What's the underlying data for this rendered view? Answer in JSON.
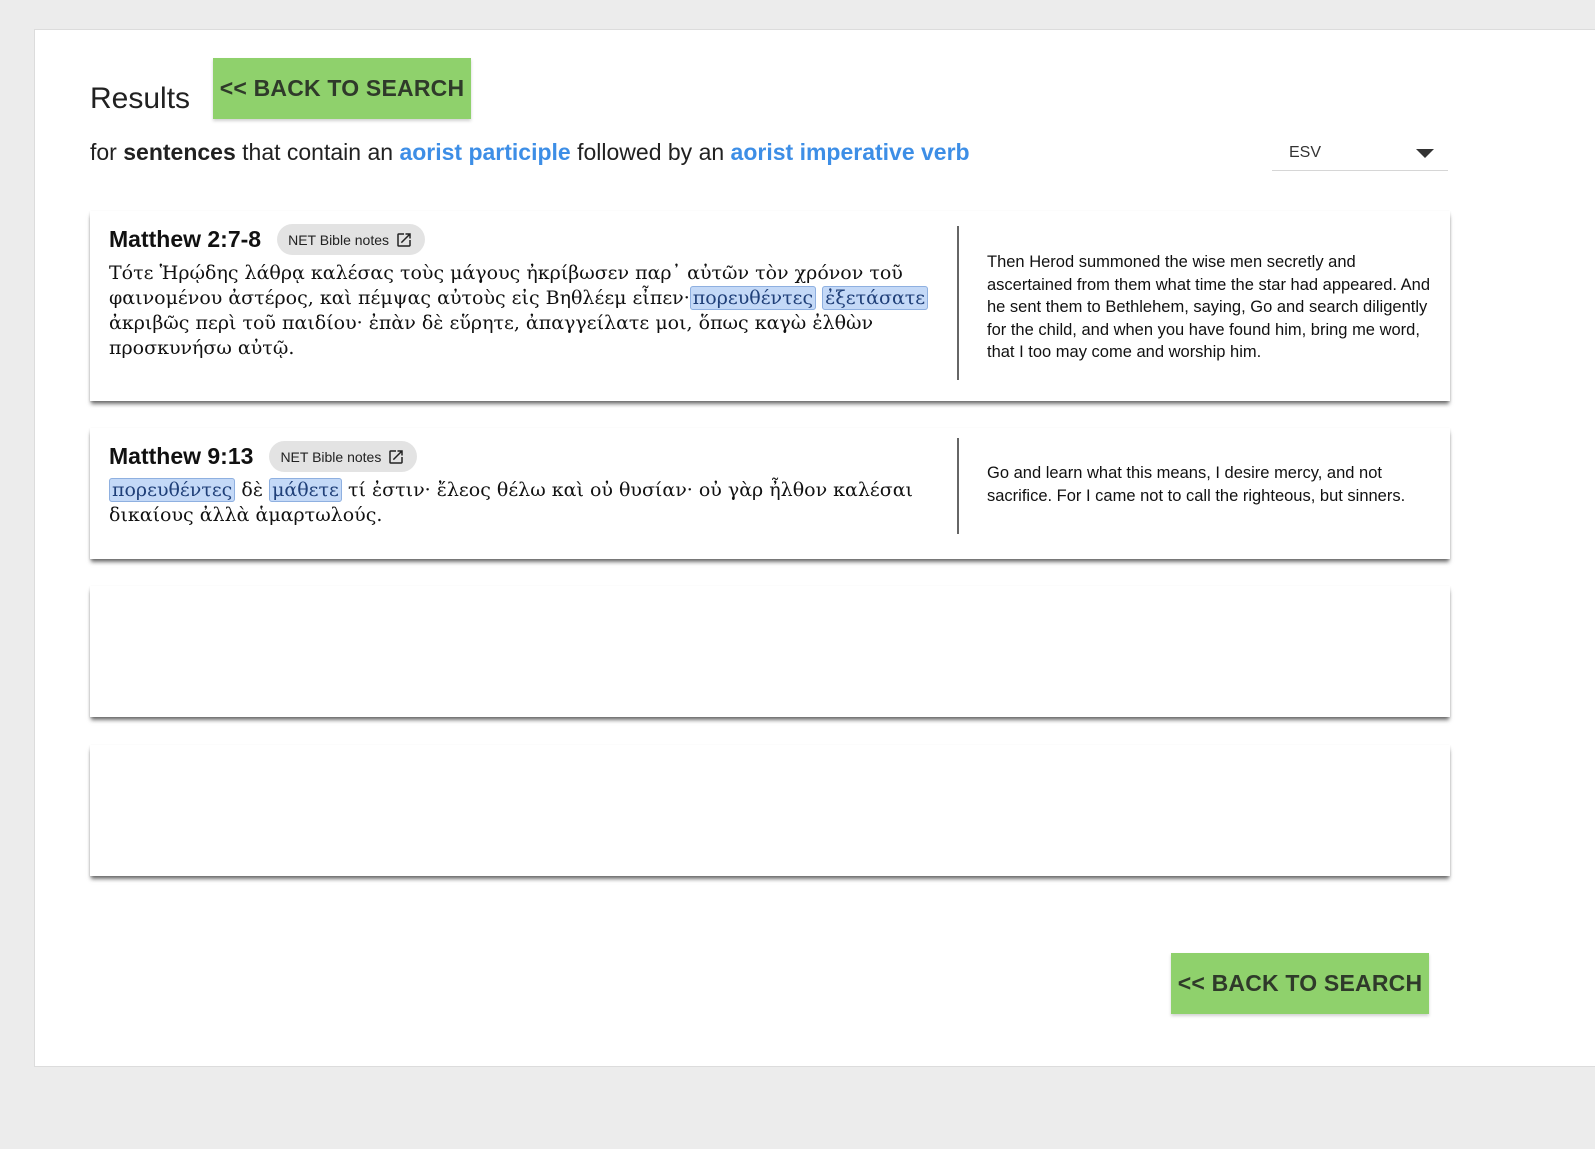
{
  "header": {
    "title": "Results",
    "back_label": "<< BACK TO SEARCH"
  },
  "query": {
    "p1": "for ",
    "p2": "sentences",
    "p3": " that contain an ",
    "term1": "aorist participle",
    "p4": " followed by an ",
    "term2": "aorist imperative verb"
  },
  "translation_select": {
    "selected": "ESV"
  },
  "results": [
    {
      "reference": "Matthew 2:7-8",
      "notes_label": "NET Bible notes",
      "greek": {
        "pre": "Τότε Ἡρῴδης λάθρᾳ καλέσας τοὺς μάγους ἠκρίβωσεν παρ᾽ αὐτῶν τὸν χρόνον τοῦ φαινομένου ἀστέρος, καὶ πέμψας αὐτοὺς εἰς Βηθλέεμ εἶπεν·",
        "h1": "πορευθέντες",
        "h2": "ἐξετάσατε",
        "post": "ἀκριβῶς περὶ τοῦ παιδίου· ἐπὰν δὲ εὕρητε, ἀπαγγείλατε μοι, ὅπως καγὼ ἐλθὼν προσκυνήσω αὐτῷ."
      },
      "english": "Then Herod summoned the wise men secretly and ascertained from them what time the star had appeared. And he sent them to Bethlehem, saying, Go and search diligently for the child, and when you have found him, bring me word, that I too may come and worship him."
    },
    {
      "reference": "Matthew 9:13",
      "notes_label": "NET Bible notes",
      "greek": {
        "h1": "πορευθέντες",
        "mid": "δὲ",
        "h2": "μάθετε",
        "post": "τί ἐστιν· ἔλεος θέλω καὶ οὐ θυσίαν· οὐ γὰρ ἦλθον καλέσαι δικαίους ἀλλὰ ἁμαρτωλούς."
      },
      "english": "Go and learn what this means, I desire mercy, and not sacrifice. For I came not to call the righteous, but sinners."
    }
  ],
  "icons": {
    "external_link": "open-in-new-icon",
    "dropdown": "arrow-drop-down-icon"
  }
}
